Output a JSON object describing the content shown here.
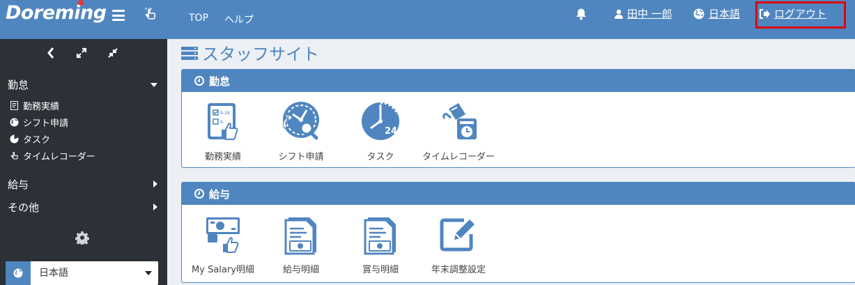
{
  "header": {
    "logo": "Doreming",
    "nav": [
      "TOP",
      "ヘルプ"
    ],
    "user_name": "田中 一郎",
    "language": "日本語",
    "logout": "ログアウト"
  },
  "sidebar": {
    "sections": [
      {
        "label": "勤怠",
        "expanded": true,
        "items": [
          "勤務実績",
          "シフト申請",
          "タスク",
          "タイムレコーダー"
        ]
      },
      {
        "label": "給与",
        "expanded": false
      },
      {
        "label": "その他",
        "expanded": false
      }
    ],
    "language_select": "日本語"
  },
  "main": {
    "title": "スタッフサイト",
    "panels": [
      {
        "title": "勤怠",
        "tiles": [
          "勤務実績",
          "シフト申請",
          "タスク",
          "タイムレコーダー"
        ]
      },
      {
        "title": "給与",
        "tiles": [
          "My Salary明細",
          "給与明細",
          "賞与明細",
          "年末調整設定"
        ]
      }
    ],
    "task_icon_number": "24"
  },
  "colors": {
    "header": "#4f86c0",
    "sidebar": "#2b3137",
    "highlight": "#e00000"
  }
}
